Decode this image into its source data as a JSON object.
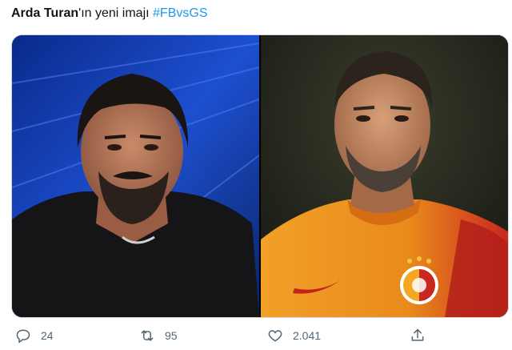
{
  "tweet": {
    "author_mention": "Arda Turan",
    "text_suffix": "'ın yeni imajı ",
    "hashtag": "#FBvsGS"
  },
  "media": {
    "images": [
      {
        "subject": "older man with dark hair and beard in black shirt, blue studio background"
      },
      {
        "subject": "Arda Turan in Galatasaray orange-red jersey"
      }
    ]
  },
  "actions": {
    "reply_count": "24",
    "retweet_count": "95",
    "like_count": "2.041"
  },
  "colors": {
    "text": "#0f1419",
    "hashtag": "#1d9bf0",
    "icon": "#536471"
  },
  "icons": [
    "reply-icon",
    "retweet-icon",
    "like-icon",
    "share-icon"
  ]
}
